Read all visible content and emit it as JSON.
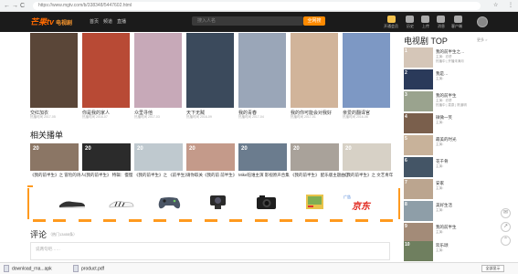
{
  "browser": {
    "url": "https://www.mgtv.com/b/338348/5447602.html",
    "back": "←",
    "forward": "→",
    "reload": "C",
    "star": "☆",
    "menu": "⋮"
  },
  "header": {
    "logo": "芒果tv",
    "logo_sub": "电视剧",
    "nav": [
      "首页",
      "频道",
      "直播"
    ],
    "search_placeholder": "搜入人名",
    "search_button": "全网搜",
    "icons": [
      {
        "name": "vip",
        "label": "开通会员",
        "color": "#f2c14e"
      },
      {
        "name": "history",
        "label": "历史",
        "color": "#aaaaaa"
      },
      {
        "name": "upload",
        "label": "上传",
        "color": "#aaaaaa"
      },
      {
        "name": "message",
        "label": "消息",
        "color": "#aaaaaa"
      },
      {
        "name": "client",
        "label": "客户端",
        "color": "#aaaaaa"
      }
    ]
  },
  "posters": [
    {
      "title": "交红加衣",
      "meta": "热播时间 2017-05",
      "bg": "#5a4638"
    },
    {
      "title": "你是我的家人",
      "meta": "热播时间 2016-07",
      "bg": "#b84a35"
    },
    {
      "title": "众里寻他",
      "meta": "热播时间 2017-03",
      "bg": "#c7a9b8"
    },
    {
      "title": "天下无贼",
      "meta": "热播时间 2016-09",
      "bg": "#3b4a5c"
    },
    {
      "title": "我的青春",
      "meta": "热播时间 2017-04",
      "bg": "#9aa6b8"
    },
    {
      "title": "我的你可能会对我好",
      "meta": "热播时间 2017-01",
      "bg": "#d1b49a"
    },
    {
      "title": "亲爱的翻译官",
      "meta": "热播时间 2016-06",
      "bg": "#7d98c4"
    }
  ],
  "related": {
    "title": "相关播单",
    "items": [
      {
        "count": "20",
        "caption": "《我的前半生》之 冒险的诗人",
        "bg": "#8b7665"
      },
      {
        "count": "20",
        "caption": "《我的前半生》 特辑：慢慢",
        "bg": "#2b2b2b"
      },
      {
        "count": "20",
        "caption": "《我的前半生》之 《前半生》",
        "bg": "#bfc9cf"
      },
      {
        "count": "20",
        "caption": "请你取关《我的前 前半生》",
        "bg": "#c49a8a"
      },
      {
        "count": "20",
        "caption": "Mike陪谁主演 影视原声合集",
        "bg": "#6b7c8e"
      },
      {
        "count": "20",
        "caption": "《我的前半生》 配乐版主题曲了",
        "bg": "#a9a29a"
      },
      {
        "count": "20",
        "caption": "《我的前半生》之 文艺青年",
        "bg": "#d7d1c6"
      }
    ]
  },
  "ads": {
    "label": "广告",
    "products": [
      "sneaker",
      "striped-shoe",
      "game-controller",
      "webcam",
      "camera",
      "lego-box",
      "jd-logo"
    ],
    "jd_text": "京东"
  },
  "comments": {
    "title": "评论",
    "sub": "（热门13455条）",
    "placeholder": "说两句吧……"
  },
  "rail": {
    "title": "电视剧 TOP",
    "more": "更多 >",
    "items": [
      {
        "rank": "1",
        "name": "我的前半生之…",
        "cast": "主演：亦舒",
        "sub": "热播中 | 开播未满月",
        "bg": "#d5c6b8"
      },
      {
        "rank": "2",
        "name": "我是…",
        "cast": "主演：",
        "sub": "",
        "bg": "#2a3a5a"
      },
      {
        "rank": "3",
        "name": "我的前半生",
        "cast": "主演：亦舒",
        "sub": "热播中 | 袁泉 | 陈道明",
        "bg": "#9aa38e"
      },
      {
        "rank": "4",
        "name": "微微一笑",
        "cast": "主演：",
        "sub": "",
        "bg": "#7a5f4c"
      },
      {
        "rank": "5",
        "name": "最美的时光",
        "cast": "主演：",
        "sub": "",
        "bg": "#c8b29a"
      },
      {
        "rank": "6",
        "name": "花千骨",
        "cast": "主演：",
        "sub": "",
        "bg": "#445566"
      },
      {
        "rank": "7",
        "name": "安家",
        "cast": "主演：",
        "sub": "",
        "bg": "#bba58f"
      },
      {
        "rank": "8",
        "name": "美好生活",
        "cast": "主演：",
        "sub": "",
        "bg": "#8e9ea8"
      },
      {
        "rank": "9",
        "name": "我的前半生",
        "cast": "主演：",
        "sub": "",
        "bg": "#a38b78"
      },
      {
        "rank": "10",
        "name": "欢乐颂",
        "cast": "主演：",
        "sub": "",
        "bg": "#6f7f5f"
      }
    ]
  },
  "downloads": {
    "items": [
      "download_rna...apk",
      "product.pdf"
    ],
    "show_all": "全部显示"
  }
}
